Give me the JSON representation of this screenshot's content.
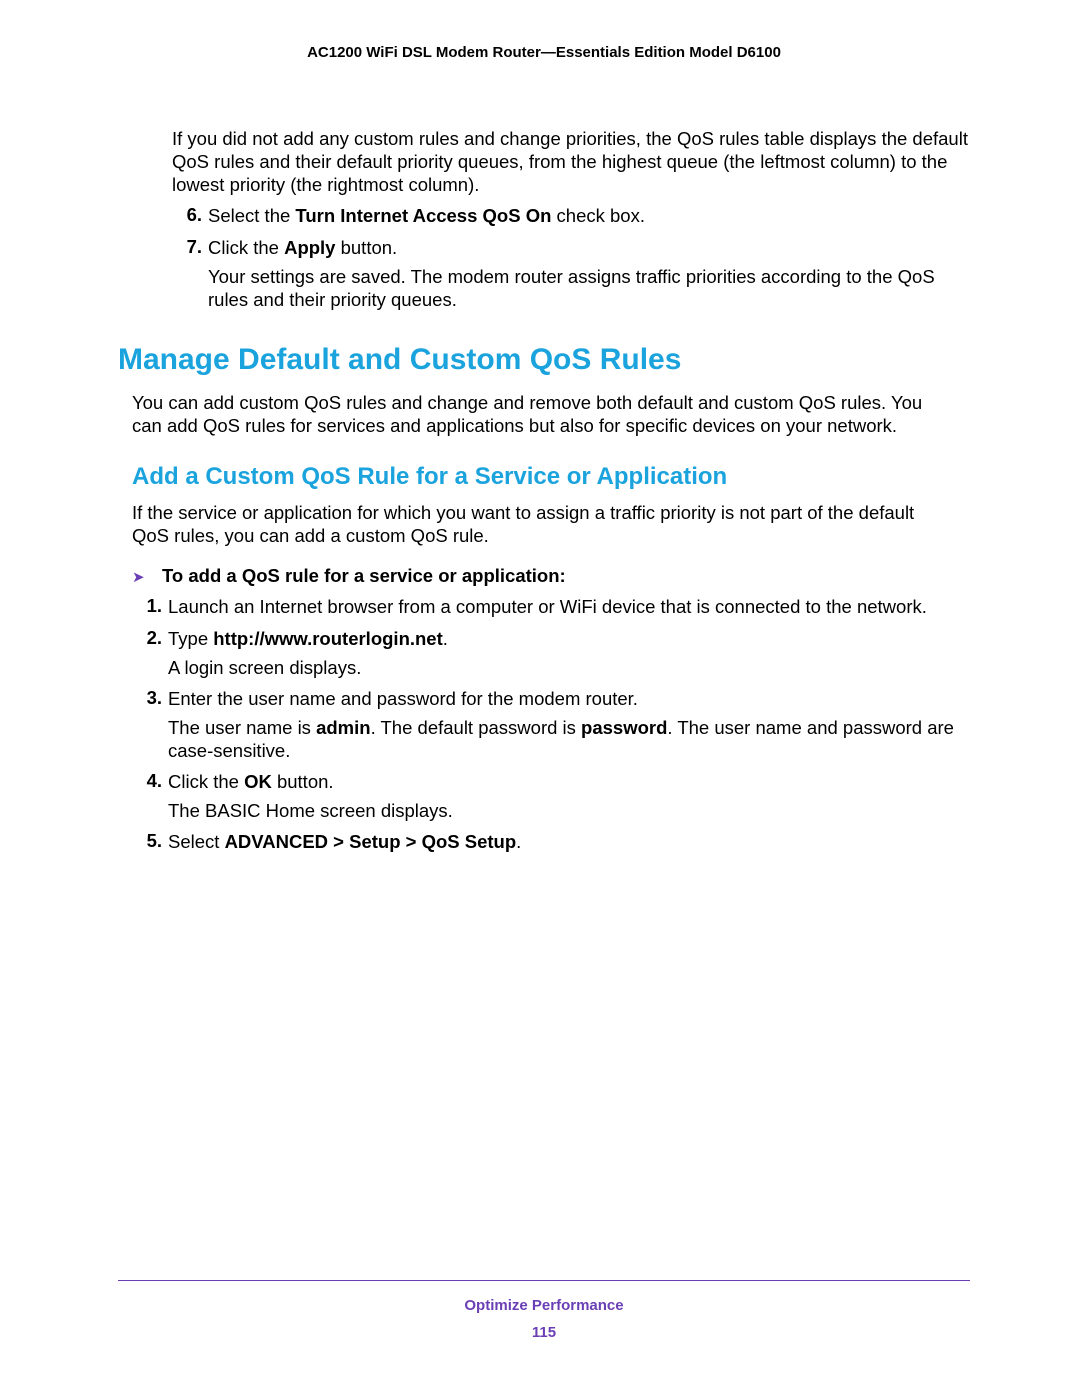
{
  "header": {
    "title": "AC1200 WiFi DSL Modem Router—Essentials Edition Model D6100"
  },
  "intro_para": "If you did not add any custom rules and change priorities, the QoS rules table displays the default QoS rules and their default priority queues, from the highest queue (the leftmost column) to the lowest priority (the rightmost column).",
  "steps_top": {
    "s6": {
      "num": "6.",
      "pre": "Select the ",
      "bold": "Turn Internet Access QoS On",
      "post": " check box."
    },
    "s7": {
      "num": "7.",
      "pre": "Click the ",
      "bold": "Apply",
      "post": " button.",
      "after": "Your settings are saved. The modem router assigns traffic priorities according to the QoS rules and their priority queues."
    }
  },
  "h1": "Manage Default and Custom QoS Rules",
  "h1_para": "You can add custom QoS rules and change and remove both default and custom QoS rules. You can add QoS rules for services and applications but also for specific devices on your network.",
  "h2": "Add a Custom QoS Rule for a Service or Application",
  "h2_para": "If the service or application for which you want to assign a traffic priority is not part of the default QoS rules, you can add a custom QoS rule.",
  "arrow_intro": "To add a QoS rule for a service or application:",
  "steps_main": {
    "s1": {
      "num": "1.",
      "text": "Launch an Internet browser from a computer or WiFi device that is connected to the network."
    },
    "s2": {
      "num": "2.",
      "pre": "Type ",
      "bold": "http://www.routerlogin.net",
      "post": ".",
      "after": "A login screen displays."
    },
    "s3": {
      "num": "3.",
      "line1": "Enter the user name and password for the modem router.",
      "l2a": "The user name is ",
      "l2b": "admin",
      "l2c": ". The default password is ",
      "l2d": "password",
      "l2e": ". The user name and password are case-sensitive."
    },
    "s4": {
      "num": "4.",
      "pre": "Click the ",
      "bold": "OK",
      "post": " button.",
      "after": "The BASIC Home screen displays."
    },
    "s5": {
      "num": "5.",
      "pre": "Select ",
      "bold": "ADVANCED > Setup > QoS Setup",
      "post": "."
    }
  },
  "footer": {
    "section": "Optimize Performance",
    "page": "115"
  }
}
